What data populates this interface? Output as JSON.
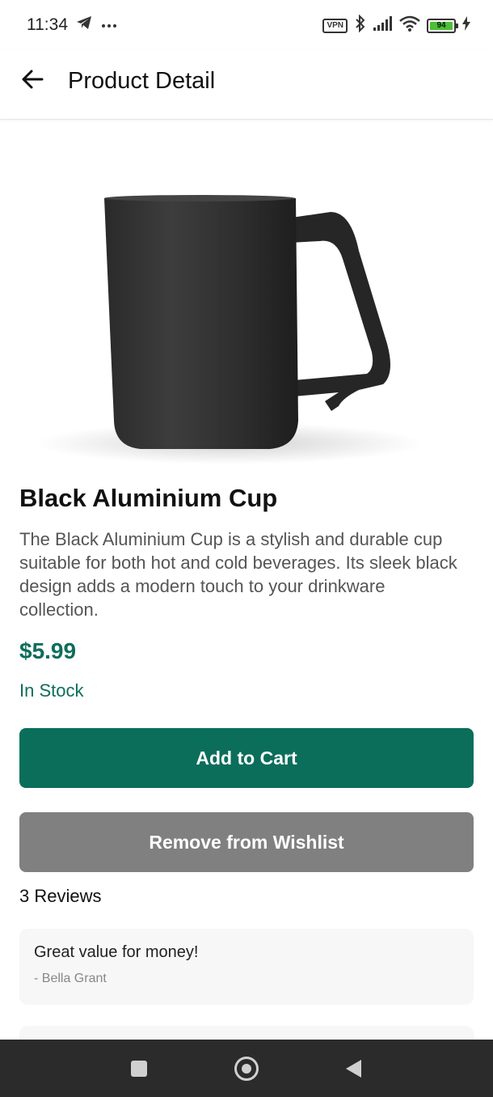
{
  "status_bar": {
    "time": "11:34",
    "battery_level": "94",
    "vpn_label": "VPN",
    "icons": [
      "telegram-icon",
      "more-dots-icon",
      "vpn-icon",
      "bluetooth-icon",
      "signal-icon",
      "wifi-icon",
      "battery-icon",
      "charging-icon"
    ]
  },
  "app_bar": {
    "title": "Product Detail",
    "back_icon": "arrow-left-icon"
  },
  "product": {
    "name": "Black Aluminium Cup",
    "description": "The Black Aluminium Cup is a stylish and durable cup suitable for both hot and cold beverages. Its sleek black design adds a modern touch to your drinkware collection.",
    "price": "$5.99",
    "stock_status": "In Stock",
    "image_subject": "black-mug"
  },
  "actions": {
    "add_to_cart_label": "Add to Cart",
    "remove_wishlist_label": "Remove from Wishlist"
  },
  "reviews": {
    "count_label": "3 Reviews",
    "items": [
      {
        "text": "Great value for money!",
        "author": "- Bella Grant"
      }
    ]
  },
  "colors": {
    "accent": "#0b6e5a",
    "secondary_button": "#808080",
    "review_card_bg": "#f7f7f7"
  },
  "nav_bar": {
    "icons": [
      "recent-apps-icon",
      "home-icon",
      "back-triangle-icon"
    ]
  }
}
